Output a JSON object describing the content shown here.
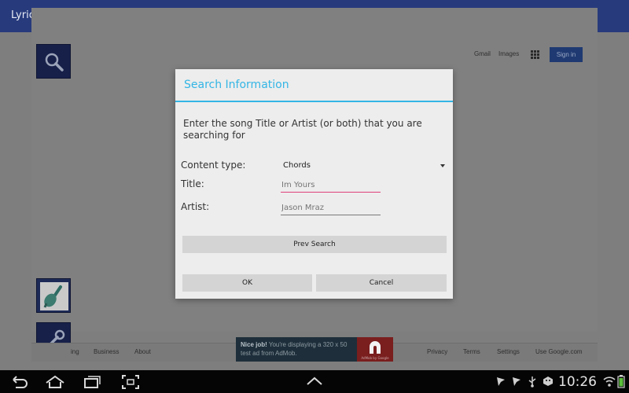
{
  "app": {
    "title": "LyricSearch"
  },
  "side_buttons": [
    {
      "name": "search",
      "icon": "search-icon"
    },
    {
      "name": "chords",
      "icon": "guitar-icon"
    },
    {
      "name": "tools",
      "icon": "wrench-icon"
    }
  ],
  "google": {
    "links": {
      "gmail": "Gmail",
      "images": "Images"
    },
    "apps_icon": "apps-grid-icon",
    "sign_in": "Sign in",
    "footer": {
      "advertising_partial": "ing",
      "business": "Business",
      "about": "About",
      "privacy": "Privacy",
      "terms": "Terms",
      "settings": "Settings",
      "use_google": "Use Google.com"
    }
  },
  "ad": {
    "headline": "Nice job!",
    "body": "You're displaying a 320 x 50 test ad from AdMob.",
    "logo_caption": "AdMob by Google"
  },
  "dialog": {
    "title": "Search Information",
    "message": "Enter the song Title or Artist (or both) that you are searching for",
    "content_type_label": "Content type:",
    "content_type_value": "Chords",
    "title_label": "Title:",
    "title_value": "Im Yours",
    "artist_label": "Artist:",
    "artist_value": "Jason Mraz",
    "prev_search": "Prev Search",
    "ok": "OK",
    "cancel": "Cancel"
  },
  "colors": {
    "accent": "#33b5e5",
    "action_bar": "#273a7c",
    "focus_underline": "#e0407a"
  },
  "system": {
    "clock": "10:26",
    "nav_icons": [
      "back-icon",
      "home-icon",
      "recents-icon",
      "screenshot-icon",
      "up-chevron-icon"
    ],
    "status_icons": [
      "notification-icon",
      "notification-icon",
      "usb-icon",
      "android-debug-icon",
      "wifi-icon",
      "battery-icon"
    ]
  }
}
